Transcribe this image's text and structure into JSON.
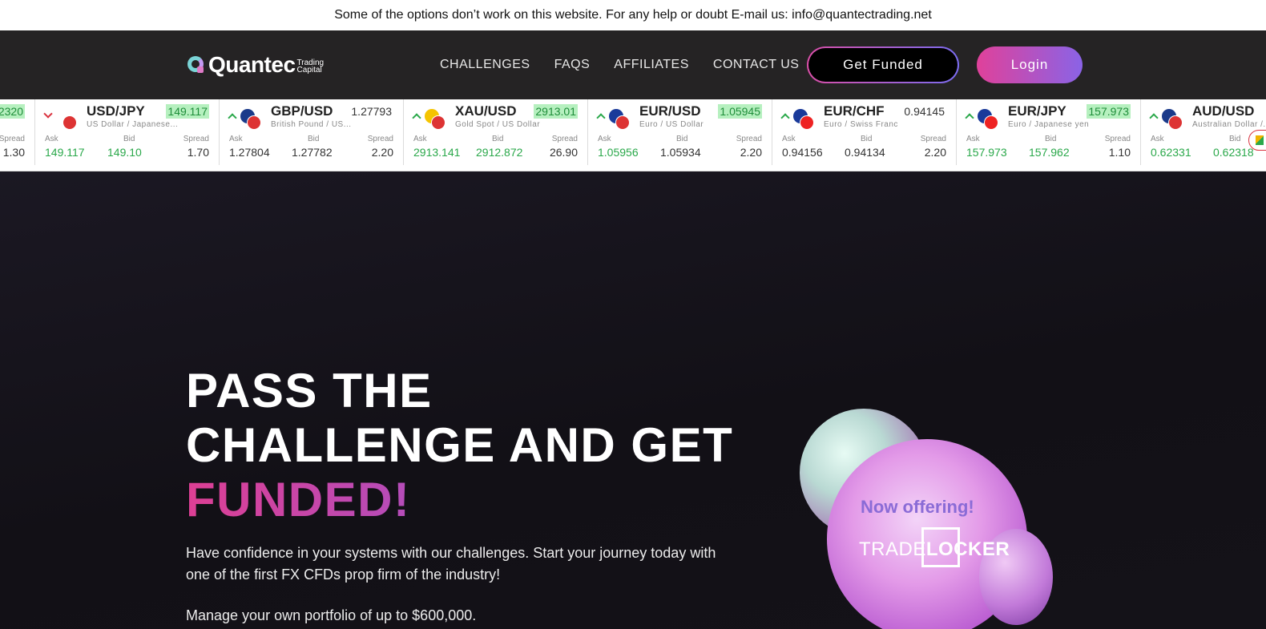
{
  "announcement": "Some of the options don’t work on this website. For any help or doubt E-mail us: info@quantectrading.net",
  "logo": {
    "name": "Quantec",
    "sub1": "Trading",
    "sub2": "Capital"
  },
  "nav": {
    "challenges": "CHALLENGES",
    "faqs": "FAQS",
    "affiliates": "AFFILIATES",
    "contact": "CONTACT US",
    "get_funded": "Get Funded",
    "login": "Login"
  },
  "ticker": {
    "labels": {
      "ask": "Ask",
      "bid": "Bid",
      "spread": "Spread"
    },
    "items": [
      {
        "symbol": "",
        "name": "",
        "price": "2320",
        "ask": "",
        "bid": "",
        "spread": "1.30",
        "dir": "up",
        "hl": true
      },
      {
        "symbol": "USD/JPY",
        "name": "US Dollar / Japanese...",
        "price": "149.117",
        "ask": "149.117",
        "bid": "149.10",
        "spread": "1.70",
        "dir": "down",
        "hl": true
      },
      {
        "symbol": "GBP/USD",
        "name": "British Pound / US...",
        "price": "1.27793",
        "ask": "1.27804",
        "bid": "1.27782",
        "spread": "2.20",
        "dir": "up",
        "hl": false
      },
      {
        "symbol": "XAU/USD",
        "name": "Gold Spot / US Dollar",
        "price": "2913.01",
        "ask": "2913.141",
        "bid": "2912.872",
        "spread": "26.90",
        "dir": "up",
        "hl": true
      },
      {
        "symbol": "EUR/USD",
        "name": "Euro / US Dollar",
        "price": "1.05945",
        "ask": "1.05956",
        "bid": "1.05934",
        "spread": "2.20",
        "dir": "up",
        "hl": true
      },
      {
        "symbol": "EUR/CHF",
        "name": "Euro / Swiss Franc",
        "price": "0.94145",
        "ask": "0.94156",
        "bid": "0.94134",
        "spread": "2.20",
        "dir": "up",
        "hl": false
      },
      {
        "symbol": "EUR/JPY",
        "name": "Euro / Japanese yen",
        "price": "157.973",
        "ask": "157.973",
        "bid": "157.962",
        "spread": "1.10",
        "dir": "up",
        "hl": true
      },
      {
        "symbol": "AUD/USD",
        "name": "Australian Dollar /...",
        "price": "",
        "ask": "0.62331",
        "bid": "0.62318",
        "spread": "",
        "dir": "up",
        "hl": false
      }
    ]
  },
  "hero": {
    "line1": "PASS THE",
    "line2": "CHALLENGE AND GET",
    "line3": "FUNDED!",
    "text": "Have confidence in your systems with our challenges. Start your journey today with one of the first FX CFDs prop firm of the industry!",
    "text2": "Manage your own portfolio of up to $600,000.",
    "offer": "Now offering!",
    "trade": "TRADE",
    "locker": "LOCKER"
  },
  "colors": {
    "accent_pink": "#dd3f94",
    "accent_purple": "#7a5ff0",
    "up": "#2aa84a",
    "down": "#d9333f"
  }
}
